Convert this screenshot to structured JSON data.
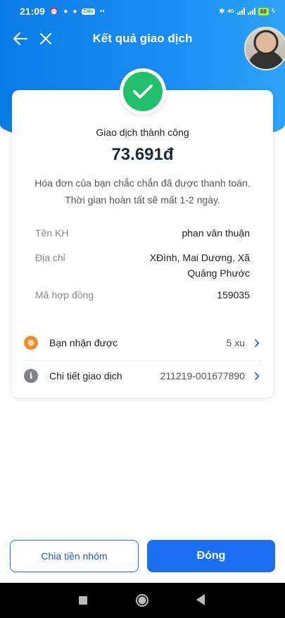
{
  "status_bar": {
    "time": "21:09",
    "network": "4G",
    "battery": "88"
  },
  "header": {
    "title": "Kết quả giao dịch",
    "back_icon": "arrow-left-icon",
    "close_icon": "close-icon"
  },
  "result": {
    "status": "Giao dịch thành công",
    "amount": "73.691đ",
    "note": "Hóa đơn của bạn chắc chắn đã được thanh toán. Thời gian hoàn tất sẽ mất 1-2 ngày."
  },
  "details": [
    {
      "label": "Tên KH",
      "value": "phan văn thuận"
    },
    {
      "label": "Địa chỉ",
      "value": "XĐình, Mai Dương, Xã Quảng Phước"
    },
    {
      "label": "Mã hợp đồng",
      "value": "159035"
    }
  ],
  "reward": {
    "label": "Bạn nhận được",
    "value": "5 xu"
  },
  "transaction": {
    "label": "Chi tiết giao dịch",
    "value": "211219-001677890"
  },
  "buttons": {
    "split": "Chia tiền nhóm",
    "close": "Đóng"
  },
  "colors": {
    "primary": "#1a6ff0",
    "success": "#1fbf6b",
    "header": "#1a8ef5"
  }
}
